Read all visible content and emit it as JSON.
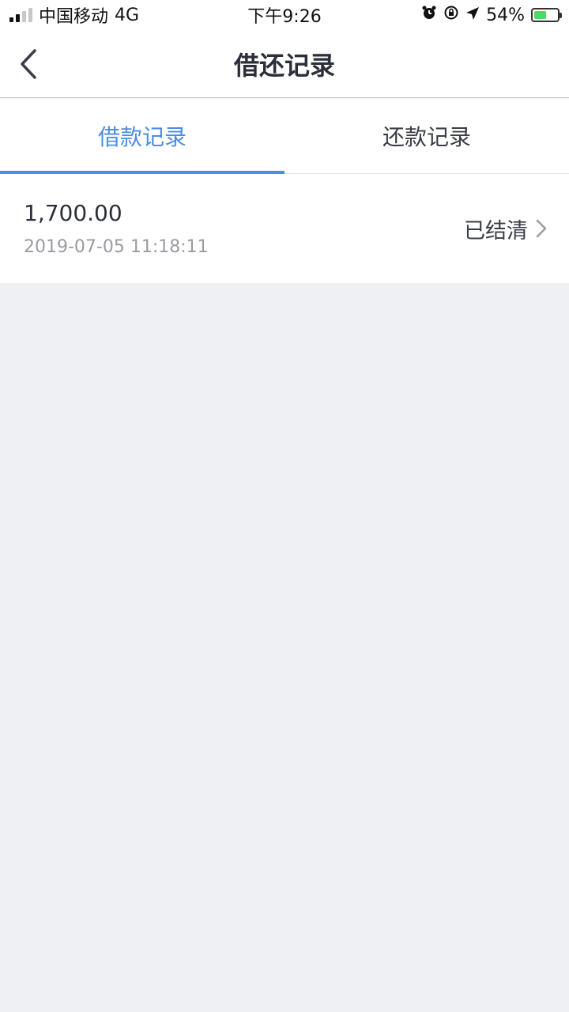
{
  "status_bar": {
    "carrier": "中国移动",
    "network": "4G",
    "time": "下午9:26",
    "battery_percent": "54%",
    "battery_level": 0.54
  },
  "nav": {
    "title": "借还记录"
  },
  "tabs": [
    {
      "label": "借款记录",
      "active": true
    },
    {
      "label": "还款记录",
      "active": false
    }
  ],
  "records": [
    {
      "amount": "1,700.00",
      "datetime": "2019-07-05 11:18:11",
      "status": "已结清"
    }
  ],
  "colors": {
    "accent": "#4a8de6",
    "background": "#eff0f4",
    "text_primary": "#2b2f3a",
    "text_secondary": "#9a9ca3"
  },
  "icons": {
    "back": "chevron-left-icon",
    "row_arrow": "chevron-right-icon",
    "alarm": "alarm-icon",
    "orientation_lock": "orientation-lock-icon",
    "location": "location-arrow-icon",
    "battery": "battery-charging-icon"
  }
}
